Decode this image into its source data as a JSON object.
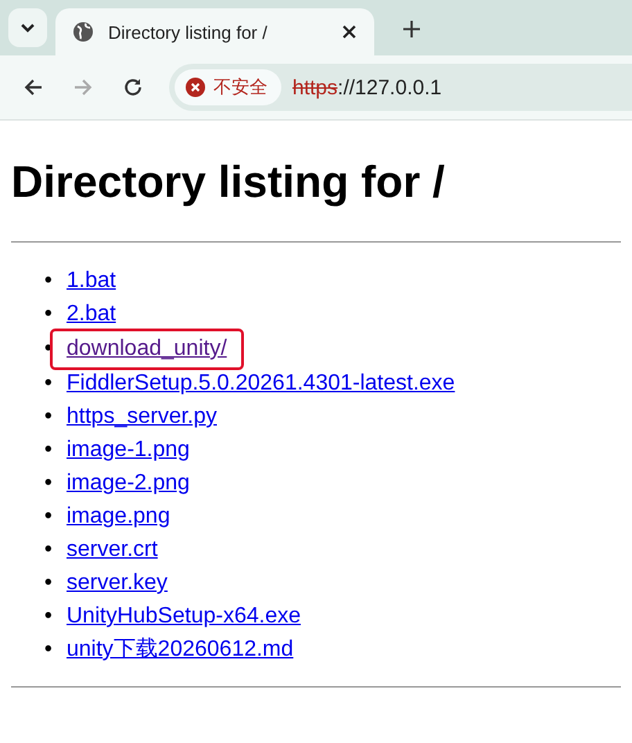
{
  "tab": {
    "title": "Directory listing for /",
    "selected": true
  },
  "address_bar": {
    "security_label": "不安全",
    "scheme": "https",
    "rest": "://127.0.0.1"
  },
  "heading": "Directory listing for /",
  "files": [
    {
      "bullet": "•",
      "name": "1.bat",
      "visited": false,
      "highlighted": false
    },
    {
      "bullet": "•",
      "name": "2.bat",
      "visited": false,
      "highlighted": false
    },
    {
      "bullet": "•",
      "name": "download_unity/",
      "visited": true,
      "highlighted": true
    },
    {
      "bullet": "•",
      "name": "FiddlerSetup.5.0.20261.4301-latest.exe",
      "visited": false,
      "highlighted": false
    },
    {
      "bullet": "•",
      "name": "https_server.py",
      "visited": false,
      "highlighted": false
    },
    {
      "bullet": "•",
      "name": "image-1.png",
      "visited": false,
      "highlighted": false
    },
    {
      "bullet": "•",
      "name": "image-2.png",
      "visited": false,
      "highlighted": false
    },
    {
      "bullet": "•",
      "name": "image.png",
      "visited": false,
      "highlighted": false
    },
    {
      "bullet": "•",
      "name": "server.crt",
      "visited": false,
      "highlighted": false
    },
    {
      "bullet": "•",
      "name": "server.key",
      "visited": false,
      "highlighted": false
    },
    {
      "bullet": "•",
      "name": "UnityHubSetup-x64.exe",
      "visited": false,
      "highlighted": false
    },
    {
      "bullet": "•",
      "name": "unity下载20260612.md",
      "visited": false,
      "highlighted": false
    }
  ]
}
